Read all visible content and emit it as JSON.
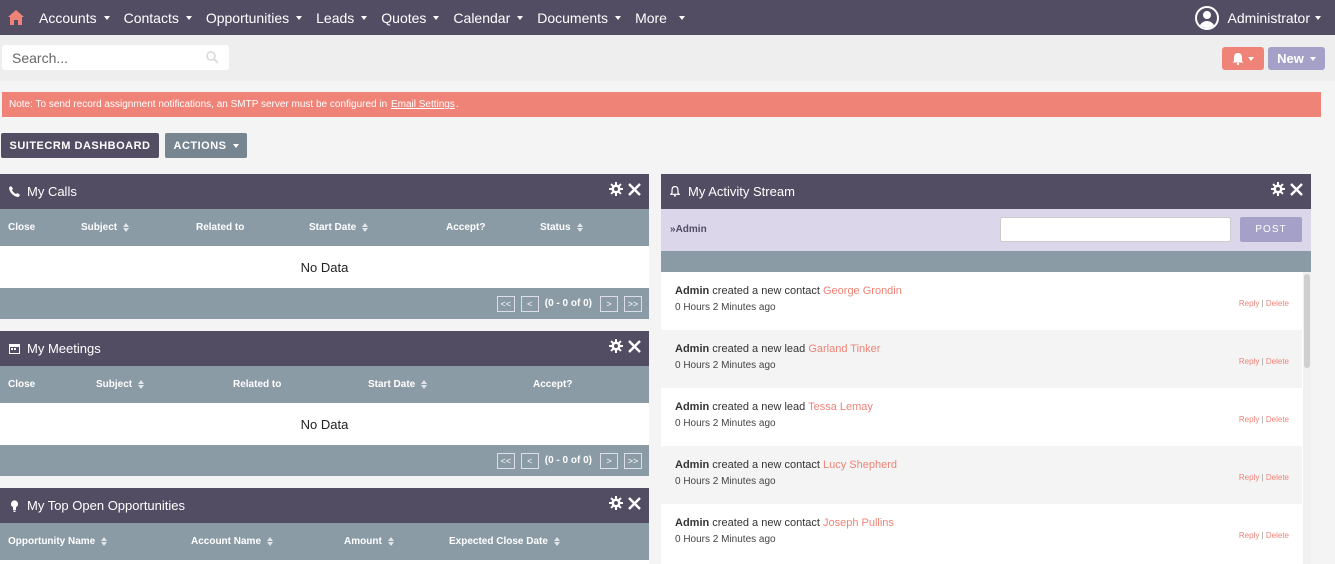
{
  "nav": {
    "items": [
      "Accounts",
      "Contacts",
      "Opportunities",
      "Leads",
      "Quotes",
      "Calendar",
      "Documents",
      "More"
    ],
    "user": "Administrator"
  },
  "search": {
    "placeholder": "Search..."
  },
  "toolbar": {
    "new_label": "New"
  },
  "notice": {
    "text_before": "Note: To send record assignment notifications, an SMTP server must be configured in",
    "link": "Email Settings",
    "text_after": "."
  },
  "dashboard": {
    "tab_label": "SUITECRM DASHBOARD",
    "actions_label": "ACTIONS"
  },
  "my_calls": {
    "title": "My Calls",
    "columns": [
      "Close",
      "Subject",
      "Related to",
      "Start Date",
      "Accept?",
      "Status"
    ],
    "empty": "No Data",
    "pager": {
      "first": "<<",
      "prev": "<",
      "info": "(0 - 0 of 0)",
      "next": ">",
      "last": ">>"
    }
  },
  "my_meetings": {
    "title": "My Meetings",
    "columns": [
      "Close",
      "Subject",
      "Related to",
      "Start Date",
      "Accept?"
    ],
    "empty": "No Data",
    "pager": {
      "first": "<<",
      "prev": "<",
      "info": "(0 - 0 of 0)",
      "next": ">",
      "last": ">>"
    }
  },
  "my_opps": {
    "title": "My Top Open Opportunities",
    "columns": [
      "Opportunity Name",
      "Account Name",
      "Amount",
      "Expected Close Date"
    ]
  },
  "activity": {
    "title": "My Activity Stream",
    "user_filter": "Admin",
    "post_label": "POST",
    "reply": "Reply",
    "delete": "Delete",
    "entries": [
      {
        "actor": "Admin",
        "action": "created a new contact",
        "target": "George Grondin",
        "time": "0 Hours 2 Minutes ago"
      },
      {
        "actor": "Admin",
        "action": "created a new lead",
        "target": "Garland Tinker",
        "time": "0 Hours 2 Minutes ago"
      },
      {
        "actor": "Admin",
        "action": "created a new lead",
        "target": "Tessa Lemay",
        "time": "0 Hours 2 Minutes ago"
      },
      {
        "actor": "Admin",
        "action": "created a new contact",
        "target": "Lucy Shepherd",
        "time": "0 Hours 2 Minutes ago"
      },
      {
        "actor": "Admin",
        "action": "created a new contact",
        "target": "Joseph Pullins",
        "time": "0 Hours 2 Minutes ago"
      }
    ]
  },
  "colors": {
    "nav_bg": "#534d64",
    "accent": "#f08377",
    "new_button": "#a5a0c8",
    "table_header": "#8b9ba6"
  },
  "icons": [
    "home-icon",
    "user-icon",
    "bell-icon",
    "search-icon",
    "phone-icon",
    "calendar-icon",
    "lightbulb-icon",
    "gear-icon",
    "close-icon"
  ]
}
